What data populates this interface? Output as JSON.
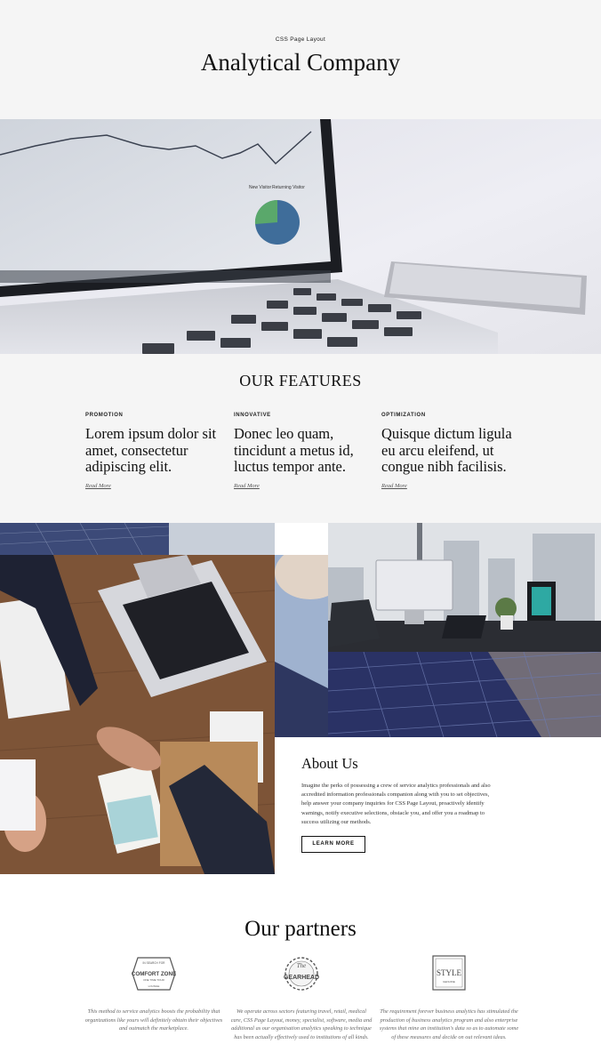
{
  "header": {
    "eyebrow": "CSS Page Layout",
    "title": "Analytical Company"
  },
  "hero": {
    "screen_legend": [
      "New Visitor",
      "Returning Visitor"
    ]
  },
  "features": {
    "title": "OUR FEATURES",
    "items": [
      {
        "category": "PROMOTION",
        "text": "Lorem ipsum dolor sit amet, consectetur adipiscing elit.",
        "link": "Read More"
      },
      {
        "category": "INNOVATIVE",
        "text": "Donec leo quam, tincidunt a metus id, luctus tempor ante.",
        "link": "Read More"
      },
      {
        "category": "OPTIMIZATION",
        "text": "Quisque dictum ligula eu arcu eleifend, ut congue nibh facilisis.",
        "link": "Read More"
      }
    ]
  },
  "about": {
    "title": "About Us",
    "text": "Imagine the perks of possessing a crew of service analytics professionals and also accredited information professionals companion along with you to set objectives, help answer your company inquiries for CSS Page Layout, proactively identify warnings, notify executive selections, obstacle you, and offer you a roadmap to success utilizing our methods.",
    "button": "LEARN MORE"
  },
  "partners": {
    "title": "Our partners",
    "items": [
      {
        "logo_name": "comfort-zone-logo",
        "logo_text": [
          "IN SEARCH FOR",
          "COMFORT ZONE",
          "ONE TIME TOUR",
          "LOUNGE"
        ],
        "text": "This method to service analytics boosts the probability that organizations like yours will definitely obtain their objectives and outmatch the marketplace."
      },
      {
        "logo_name": "the-gearhead-logo",
        "logo_text": [
          "The",
          "GEARHEAD"
        ],
        "text": "We operate across sectors featuring travel, retail, medical care, CSS Page Layout, money, specialist, software, media and additional as our organisation analytics speaking to technique has been actually effectively used to institutions of all kinds."
      },
      {
        "logo_name": "style-logo",
        "logo_text": [
          "STYLE",
          "GENUINE"
        ],
        "text": "The requirement forever business analytics has stimulated the production of business analytics program and also enterprise systems that mine an institution's data so as to automate some of these measures and decide on out relevant ideas."
      }
    ]
  },
  "colors": {
    "page_bg": "#f5f5f5",
    "white": "#ffffff",
    "text": "#111111",
    "muted": "#666666"
  }
}
